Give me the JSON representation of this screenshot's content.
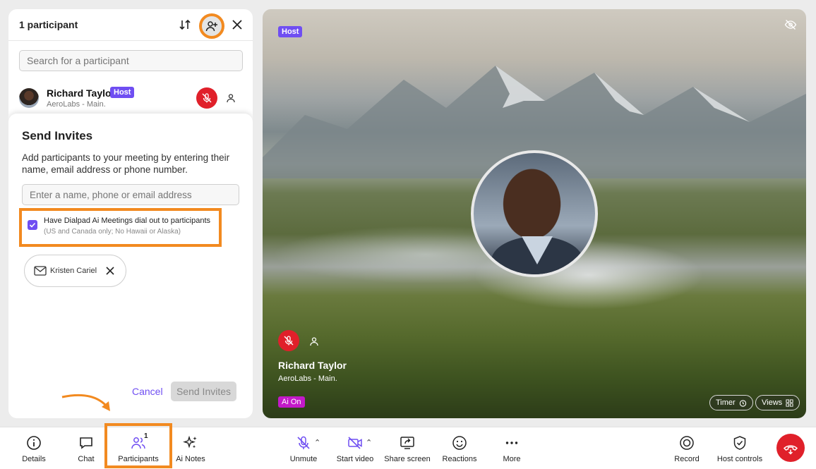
{
  "panel": {
    "title": "1 participant",
    "search_placeholder": "Search for a participant",
    "participant": {
      "name": "Richard Taylor",
      "badge": "Host",
      "subtitle": "AeroLabs - Main."
    }
  },
  "invite": {
    "title": "Send Invites",
    "description": "Add participants to your meeting by entering their name, email address or phone number.",
    "input_placeholder": "Enter a name, phone or email address",
    "dialout_label": "Have Dialpad Ai Meetings dial out to participants",
    "dialout_sub": "(US and Canada only; No Hawaii or Alaska)",
    "dialout_checked": true,
    "chip_name": "Kristen Cariel",
    "cancel_label": "Cancel",
    "send_label": "Send Invites"
  },
  "video": {
    "host_tag": "Host",
    "name": "Richard Taylor",
    "subtitle": "AeroLabs - Main.",
    "ai_tag": "Ai On",
    "timer_label": "Timer",
    "views_label": "Views"
  },
  "toolbar": {
    "details": "Details",
    "chat": "Chat",
    "participants": "Participants",
    "participants_count": "1",
    "ai_notes": "Ai Notes",
    "unmute": "Unmute",
    "start_video": "Start video",
    "share_screen": "Share screen",
    "reactions": "Reactions",
    "more": "More",
    "record": "Record",
    "host_controls": "Host controls"
  },
  "colors": {
    "accent": "#6f4ef2",
    "highlight": "#f28a20",
    "danger": "#e0202a"
  }
}
